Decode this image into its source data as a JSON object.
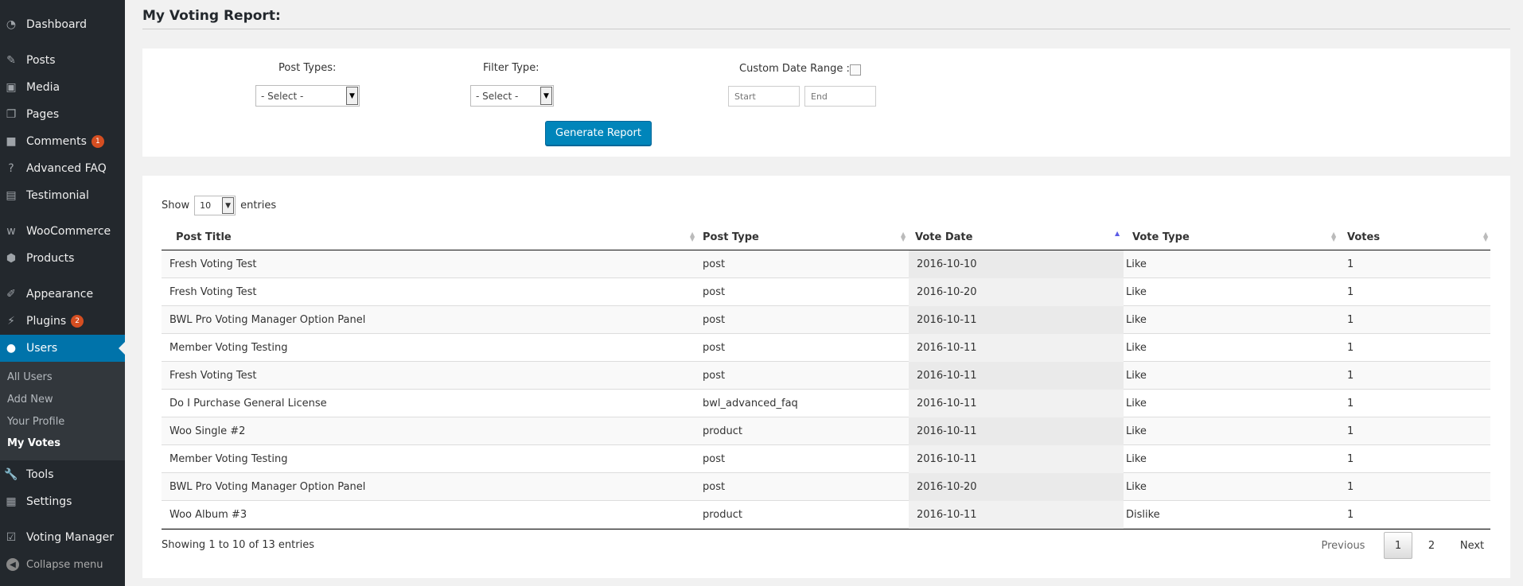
{
  "sidebar": {
    "items": [
      {
        "label": "Dashboard",
        "icon": "dashboard-icon",
        "glyph": "◔"
      },
      {
        "label": "Posts",
        "icon": "pin-icon",
        "glyph": "✎"
      },
      {
        "label": "Media",
        "icon": "media-icon",
        "glyph": "▣"
      },
      {
        "label": "Pages",
        "icon": "pages-icon",
        "glyph": "❐"
      },
      {
        "label": "Comments",
        "icon": "comment-icon",
        "glyph": "■",
        "badge": "1"
      },
      {
        "label": "Advanced FAQ",
        "icon": "help-icon",
        "glyph": "?"
      },
      {
        "label": "Testimonial",
        "icon": "document-icon",
        "glyph": "▤"
      },
      {
        "label": "WooCommerce",
        "icon": "woocommerce-icon",
        "glyph": "w"
      },
      {
        "label": "Products",
        "icon": "box-icon",
        "glyph": "⬢"
      },
      {
        "label": "Appearance",
        "icon": "brush-icon",
        "glyph": "✐"
      },
      {
        "label": "Plugins",
        "icon": "plug-icon",
        "glyph": "⚡",
        "badge": "2"
      },
      {
        "label": "Users",
        "icon": "user-icon",
        "glyph": "●"
      },
      {
        "label": "Tools",
        "icon": "wrench-icon",
        "glyph": "🔧"
      },
      {
        "label": "Settings",
        "icon": "settings-icon",
        "glyph": "▦"
      },
      {
        "label": "Voting Manager",
        "icon": "checkbox-icon",
        "glyph": "☑"
      }
    ],
    "submenu": [
      "All Users",
      "Add New",
      "Your Profile",
      "My Votes"
    ],
    "collapse_label": "Collapse menu"
  },
  "page_title": "My Voting Report:",
  "filters": {
    "post_types_label": "Post Types:",
    "post_types_value": "- Select -",
    "filter_type_label": "Filter Type:",
    "filter_type_value": "- Select -",
    "custom_range_label": "Custom Date Range :",
    "start_placeholder": "Start",
    "end_placeholder": "End",
    "generate_label": "Generate Report"
  },
  "table": {
    "show_label": "Show",
    "length_value": "10",
    "entries_label": "entries",
    "columns": [
      "Post Title",
      "Post Type",
      "Vote Date",
      "Vote Type",
      "Votes"
    ],
    "rows": [
      [
        "Fresh Voting Test",
        "post",
        "2016-10-10",
        "Like",
        "1"
      ],
      [
        "Fresh Voting Test",
        "post",
        "2016-10-20",
        "Like",
        "1"
      ],
      [
        "BWL Pro Voting Manager Option Panel",
        "post",
        "2016-10-11",
        "Like",
        "1"
      ],
      [
        "Member Voting Testing",
        "post",
        "2016-10-11",
        "Like",
        "1"
      ],
      [
        "Fresh Voting Test",
        "post",
        "2016-10-11",
        "Like",
        "1"
      ],
      [
        "Do I Purchase General License",
        "bwl_advanced_faq",
        "2016-10-11",
        "Like",
        "1"
      ],
      [
        "Woo Single #2",
        "product",
        "2016-10-11",
        "Like",
        "1"
      ],
      [
        "Member Voting Testing",
        "post",
        "2016-10-11",
        "Like",
        "1"
      ],
      [
        "BWL Pro Voting Manager Option Panel",
        "post",
        "2016-10-20",
        "Like",
        "1"
      ],
      [
        "Woo Album #3",
        "product",
        "2016-10-11",
        "Dislike",
        "1"
      ]
    ],
    "info": "Showing 1 to 10 of 13 entries",
    "pagination": {
      "previous": "Previous",
      "pages": [
        "1",
        "2"
      ],
      "next": "Next"
    }
  }
}
